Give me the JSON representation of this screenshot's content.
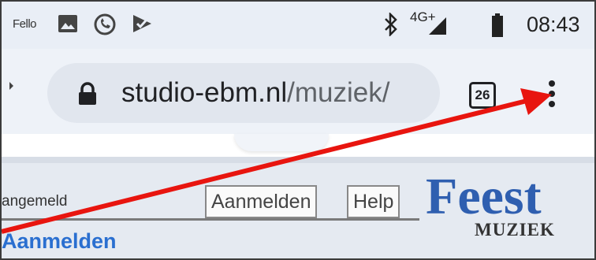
{
  "status_bar": {
    "app_name": "Fello",
    "network": "4G+",
    "time": "08:43",
    "icons": [
      "gallery-icon",
      "whatsapp-icon",
      "check-icon",
      "bluetooth-icon",
      "signal-icon",
      "battery-icon"
    ]
  },
  "browser": {
    "url_domain": "studio-ebm.nl",
    "url_path": "/muziek/",
    "tab_count": "26",
    "menu_icon": "more-vert-icon",
    "lock_icon": "lock-icon"
  },
  "page": {
    "logged_in_text": "angemeld",
    "login_button": "Aanmelden",
    "help_button": "Help",
    "heading": "Aanmelden",
    "logo_main": "Feest",
    "logo_sub": "MUZIEK"
  },
  "annotation": {
    "arrow_color": "#e8150f",
    "points_to": "more-vert-icon"
  }
}
